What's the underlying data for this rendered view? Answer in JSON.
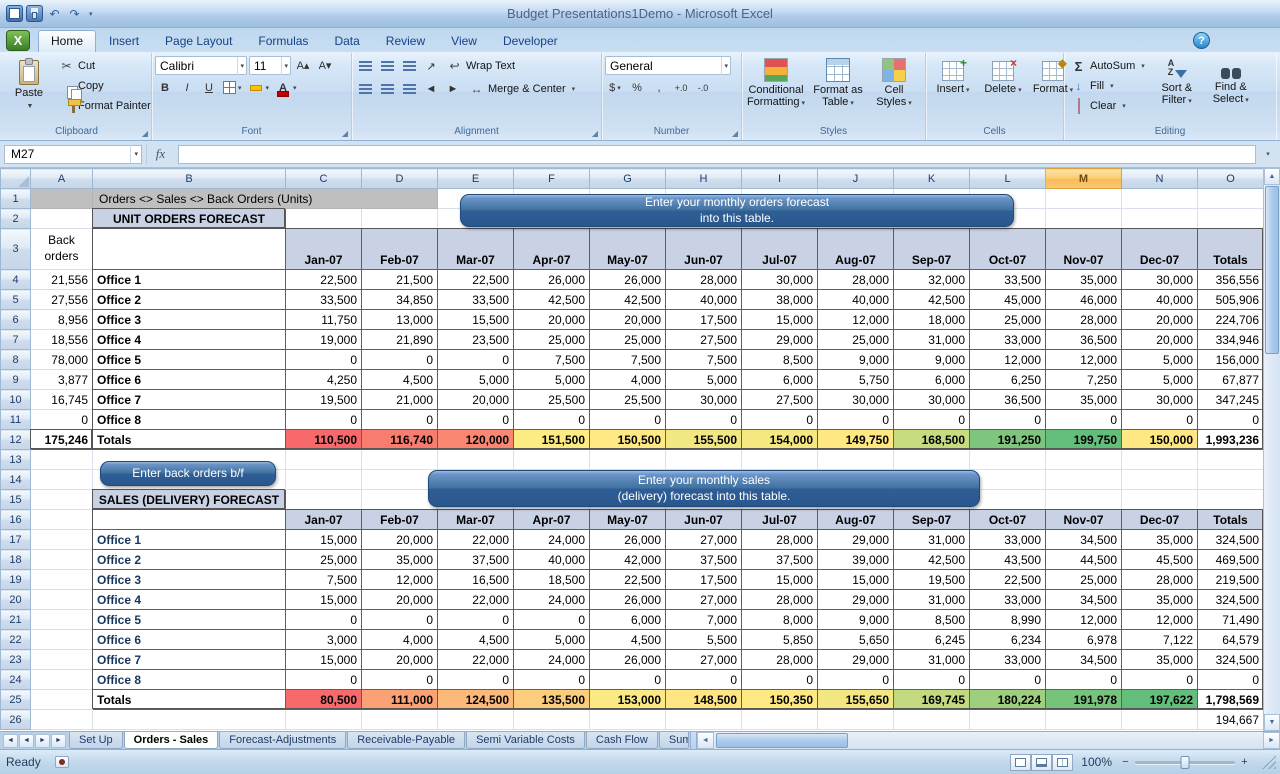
{
  "window": {
    "title": "Budget Presentations1Demo - Microsoft Excel"
  },
  "icons": {
    "dropdown": "▼",
    "dd": "▾",
    "scissors": "✂",
    "sigma": "Σ",
    "undo": "↶",
    "redo": "↷",
    "help": "?",
    "left": "◄",
    "right": "►",
    "up": "▲",
    "down": "▼",
    "wrap": "↩",
    "merge": "↔",
    "orientation": "↗",
    "fill": "↓",
    "bold": "B",
    "italic": "I",
    "underline": "U",
    "letterA": "A",
    "currency": "$",
    "percent": "%",
    "comma": ",",
    "inc_dec": "+.0",
    "dec_dec": "-.0",
    "minus": "−",
    "plus": "+",
    "launcher": "◢",
    "excel_logo": "X",
    "sort_a": "A",
    "sort_z": "Z",
    "grow": "A▴",
    "shrink": "A▾"
  },
  "ribbon_tabs": [
    {
      "label": "Home",
      "active": true
    },
    {
      "label": "Insert"
    },
    {
      "label": "Page Layout"
    },
    {
      "label": "Formulas"
    },
    {
      "label": "Data"
    },
    {
      "label": "Review"
    },
    {
      "label": "View"
    },
    {
      "label": "Developer"
    }
  ],
  "ribbon": {
    "clipboard": {
      "label": "Clipboard",
      "paste": "Paste",
      "cut": "Cut",
      "copy": "Copy",
      "format_painter": "Format Painter"
    },
    "font": {
      "label": "Font",
      "name": "Calibri",
      "size": "11"
    },
    "alignment": {
      "label": "Alignment",
      "wrap": "Wrap Text",
      "merge": "Merge & Center"
    },
    "number": {
      "label": "Number",
      "format": "General"
    },
    "styles": {
      "label": "Styles",
      "conditional": "Conditional Formatting",
      "as_table": "Format as Table",
      "cell_styles": "Cell Styles"
    },
    "cells": {
      "label": "Cells",
      "insert": "Insert",
      "delete": "Delete",
      "format": "Format"
    },
    "editing": {
      "label": "Editing",
      "autosum": "AutoSum",
      "fill": "Fill",
      "clear": "Clear",
      "sort": "Sort & Filter",
      "find": "Find & Select"
    }
  },
  "formula_bar": {
    "name_box": "M27",
    "fx": "fx"
  },
  "sheet": {
    "columns": [
      "A",
      "B",
      "C",
      "D",
      "E",
      "F",
      "G",
      "H",
      "I",
      "J",
      "K",
      "L",
      "M",
      "N",
      "O"
    ],
    "selected_column": "M",
    "title_band": "Orders <> Sales <> Back Orders (Units)",
    "months": [
      "Jan-07",
      "Feb-07",
      "Mar-07",
      "Apr-07",
      "May-07",
      "Jun-07",
      "Jul-07",
      "Aug-07",
      "Sep-07",
      "Oct-07",
      "Nov-07",
      "Dec-07"
    ],
    "totals_header": "Totals",
    "totals_label": "Totals",
    "orders_table": {
      "title": "UNIT ORDERS FORECAST",
      "back_orders_header": "Back orders",
      "rows": [
        {
          "back": 21556,
          "office": "Office 1",
          "values": [
            22500,
            21500,
            22500,
            26000,
            26000,
            28000,
            30000,
            28000,
            32000,
            33500,
            35000,
            30000
          ],
          "total": 356556
        },
        {
          "back": 27556,
          "office": "Office 2",
          "values": [
            33500,
            34850,
            33500,
            42500,
            42500,
            40000,
            38000,
            40000,
            42500,
            45000,
            46000,
            40000
          ],
          "total": 505906
        },
        {
          "back": 8956,
          "office": "Office 3",
          "values": [
            11750,
            13000,
            15500,
            20000,
            20000,
            17500,
            15000,
            12000,
            18000,
            25000,
            28000,
            20000
          ],
          "total": 224706
        },
        {
          "back": 18556,
          "office": "Office 4",
          "values": [
            19000,
            21890,
            23500,
            25000,
            25000,
            27500,
            29000,
            25000,
            31000,
            33000,
            36500,
            20000
          ],
          "total": 334946
        },
        {
          "back": 78000,
          "office": "Office 5",
          "values": [
            0,
            0,
            0,
            7500,
            7500,
            7500,
            8500,
            9000,
            9000,
            12000,
            12000,
            5000
          ],
          "total": 156000
        },
        {
          "back": 3877,
          "office": "Office 6",
          "values": [
            4250,
            4500,
            5000,
            5000,
            4000,
            5000,
            6000,
            5750,
            6000,
            6250,
            7250,
            5000
          ],
          "total": 67877
        },
        {
          "back": 16745,
          "office": "Office 7",
          "values": [
            19500,
            21000,
            20000,
            25500,
            25500,
            30000,
            27500,
            30000,
            30000,
            36500,
            35000,
            30000
          ],
          "total": 347245
        },
        {
          "back": 0,
          "office": "Office 8",
          "values": [
            0,
            0,
            0,
            0,
            0,
            0,
            0,
            0,
            0,
            0,
            0,
            0
          ],
          "total": 0
        }
      ],
      "totals": {
        "back": 175246,
        "values": [
          110500,
          116740,
          120000,
          151500,
          150500,
          155500,
          154000,
          149750,
          168500,
          191250,
          199750,
          150000
        ],
        "total": 1993236
      }
    },
    "sales_table": {
      "title": "SALES (DELIVERY) FORECAST",
      "rows": [
        {
          "office": "Office 1",
          "values": [
            15000,
            20000,
            22000,
            24000,
            26000,
            27000,
            28000,
            29000,
            31000,
            33000,
            34500,
            35000
          ],
          "total": 324500
        },
        {
          "office": "Office 2",
          "values": [
            25000,
            35000,
            37500,
            40000,
            42000,
            37500,
            37500,
            39000,
            42500,
            43500,
            44500,
            45500
          ],
          "total": 469500
        },
        {
          "office": "Office 3",
          "values": [
            7500,
            12000,
            16500,
            18500,
            22500,
            17500,
            15000,
            15000,
            19500,
            22500,
            25000,
            28000
          ],
          "total": 219500
        },
        {
          "office": "Office 4",
          "values": [
            15000,
            20000,
            22000,
            24000,
            26000,
            27000,
            28000,
            29000,
            31000,
            33000,
            34500,
            35000
          ],
          "total": 324500
        },
        {
          "office": "Office 5",
          "values": [
            0,
            0,
            0,
            0,
            6000,
            7000,
            8000,
            9000,
            8500,
            8990,
            12000,
            12000
          ],
          "total": 71490
        },
        {
          "office": "Office 6",
          "values": [
            3000,
            4000,
            4500,
            5000,
            4500,
            5500,
            5850,
            5650,
            6245,
            6234,
            6978,
            7122
          ],
          "total": 64579
        },
        {
          "office": "Office 7",
          "values": [
            15000,
            20000,
            22000,
            24000,
            26000,
            27000,
            28000,
            29000,
            31000,
            33000,
            34500,
            35000
          ],
          "total": 324500
        },
        {
          "office": "Office 8",
          "values": [
            0,
            0,
            0,
            0,
            0,
            0,
            0,
            0,
            0,
            0,
            0,
            0
          ],
          "total": 0
        }
      ],
      "totals": {
        "values": [
          80500,
          111000,
          124500,
          135500,
          153000,
          148500,
          150350,
          155650,
          169745,
          180224,
          191978,
          197622
        ],
        "total": 1798569
      }
    },
    "below_value": 194667,
    "callouts": {
      "orders_line1": "Enter your monthly  orders forecast",
      "orders_line2": "into this table.",
      "back_orders": "Enter back orders b/f",
      "sales_line1": "Enter your monthly sales",
      "sales_line2": "(delivery) forecast into this table."
    }
  },
  "sheet_tabs": [
    {
      "label": "Set Up"
    },
    {
      "label": "Orders - Sales",
      "active": true
    },
    {
      "label": "Forecast-Adjustments"
    },
    {
      "label": "Receivable-Payable"
    },
    {
      "label": "Semi Variable Costs"
    },
    {
      "label": "Cash Flow"
    },
    {
      "label": "Sum"
    }
  ],
  "status_bar": {
    "mode": "Ready",
    "zoom": "100%"
  },
  "colors": {
    "scale_min": "#F8696B",
    "scale_mid": "#FFEB84",
    "scale_max": "#63BE7B",
    "selected_column_header": "#F9BD55"
  }
}
